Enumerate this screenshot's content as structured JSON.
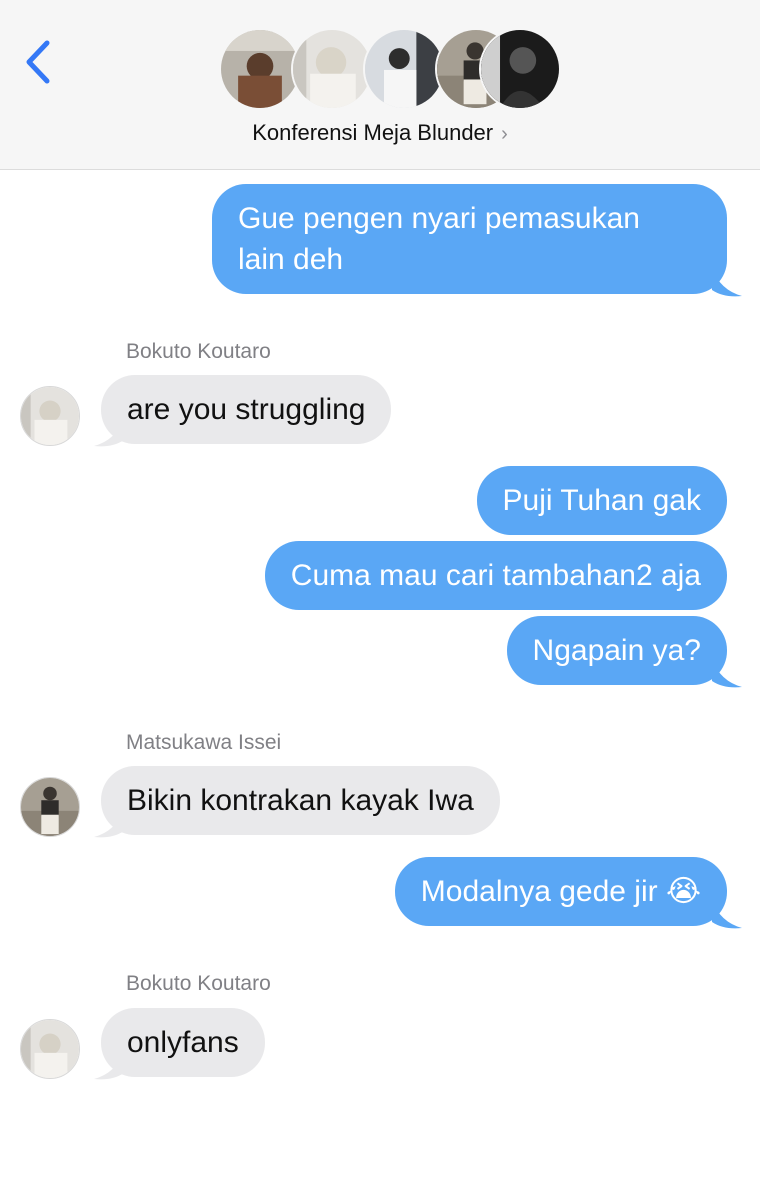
{
  "header": {
    "back_icon": "chevron-left-icon",
    "group_name": "Konferensi Meja Blunder",
    "chevron": "›",
    "accent": "#3478f6"
  },
  "messages": [
    {
      "type": "sent",
      "text_lines": [
        "Gue pengen nyari pemasukan",
        "lain deh"
      ]
    },
    {
      "type": "received",
      "sender": "Bokuto Koutaro",
      "text": "are you struggling"
    },
    {
      "type": "sent",
      "text": "Puji Tuhan gak"
    },
    {
      "type": "sent",
      "text": "Cuma mau cari tambahan2 aja"
    },
    {
      "type": "sent",
      "text": "Ngapain ya?"
    },
    {
      "type": "received",
      "sender": "Matsukawa Issei",
      "text": "Bikin kontrakan kayak Iwa"
    },
    {
      "type": "sent",
      "text": "Modalnya gede jir 😭"
    },
    {
      "type": "received",
      "sender": "Bokuto Koutaro",
      "text": "onlyfans"
    }
  ],
  "colors": {
    "sent_bubble": "#5aa7f5",
    "received_bubble": "#e9e9eb",
    "header_bg": "#f6f6f6"
  }
}
